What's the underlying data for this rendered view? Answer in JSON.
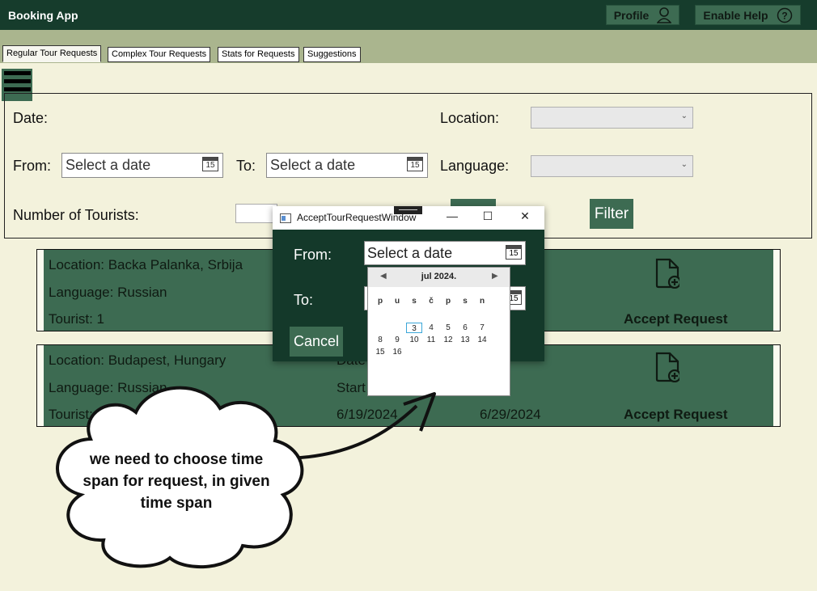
{
  "app": {
    "title": "Booking App",
    "profile_label": "Profile",
    "help_label": "Enable Help"
  },
  "tabs": [
    "Regular Tour Requests",
    "Complex Tour Requests",
    "Stats for Requests",
    "Suggestions"
  ],
  "filter": {
    "date_label": "Date:",
    "from_label": "From:",
    "to_label": "To:",
    "from_placeholder": "Select a date",
    "to_placeholder": "Select a date",
    "location_label": "Location:",
    "language_label": "Language:",
    "tourists_label": "Number of Tourists:",
    "filter_button": "Filter",
    "calendar_day": "15"
  },
  "requests": [
    {
      "location": "Location: Backa Palanka, Srbija",
      "language": "Language: Russian",
      "tourist": "Tourist: 1",
      "accept": "Accept Request"
    },
    {
      "location": "Location: Budapest, Hungary",
      "language": "Language: Russian",
      "tourist": "Tourist:",
      "date_header": "Date",
      "start": "Start",
      "date_from": "6/19/2024",
      "date_to": "6/29/2024",
      "accept": "Accept Request"
    }
  ],
  "dialog": {
    "title": "AcceptTourRequestWindow",
    "from_label": "From:",
    "to_label": "To:",
    "from_value": "Select a date",
    "cancel": "Cancel"
  },
  "calendar": {
    "month": "jul 2024.",
    "weekdays": [
      "p",
      "u",
      "s",
      "č",
      "p",
      "s",
      "n"
    ],
    "days": [
      "3",
      "4",
      "5",
      "6",
      "7",
      "8",
      "9",
      "10",
      "11",
      "12",
      "13",
      "14",
      "15",
      "16"
    ],
    "today": "3"
  },
  "annotation": {
    "text": "we need to choose time span for request, in given time span"
  },
  "colors": {
    "topbar": "#163c2c",
    "accent": "#3d6b52",
    "tabstrip": "#aab58e",
    "background": "#f3f2dc",
    "dialog": "#14392a"
  }
}
